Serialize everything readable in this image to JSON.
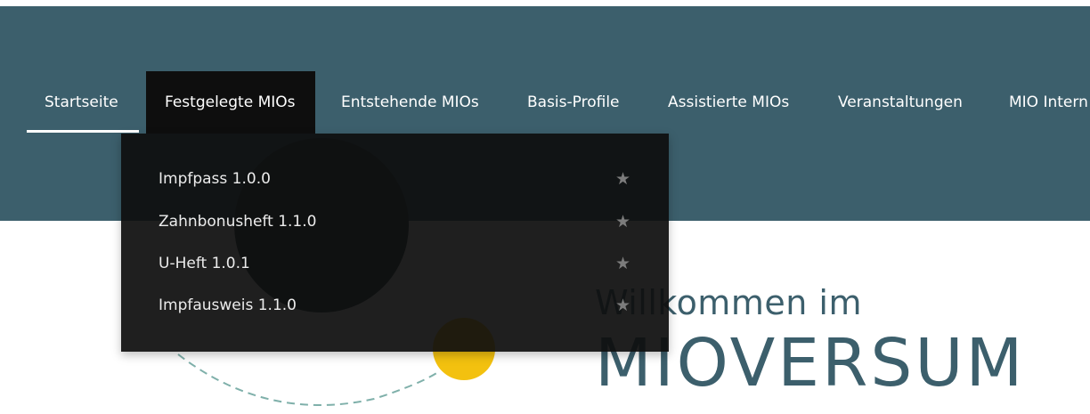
{
  "nav": {
    "items": [
      {
        "label": "Startseite"
      },
      {
        "label": "Festgelegte MIOs"
      },
      {
        "label": "Entstehende MIOs"
      },
      {
        "label": "Basis-Profile"
      },
      {
        "label": "Assistierte MIOs"
      },
      {
        "label": "Veranstaltungen"
      },
      {
        "label": "MIO Intern"
      }
    ],
    "active_index": 1,
    "current_page_index": 0
  },
  "dropdown": {
    "items": [
      {
        "label": "Impfpass 1.0.0",
        "icon": "star-icon"
      },
      {
        "label": "Zahnbonusheft 1.1.0",
        "icon": "star-icon"
      },
      {
        "label": "U-Heft 1.0.1",
        "icon": "star-icon"
      },
      {
        "label": "Impfausweis 1.1.0",
        "icon": "star-icon"
      }
    ]
  },
  "hero": {
    "welcome": "Willkommen im",
    "brand": "MIOVERSUM"
  },
  "colors": {
    "header_bg": "#3c5f6c",
    "dropdown_bg": "#0e0e0e",
    "accent_yellow": "#f3c10f",
    "brand_text": "#3c5f6c"
  }
}
